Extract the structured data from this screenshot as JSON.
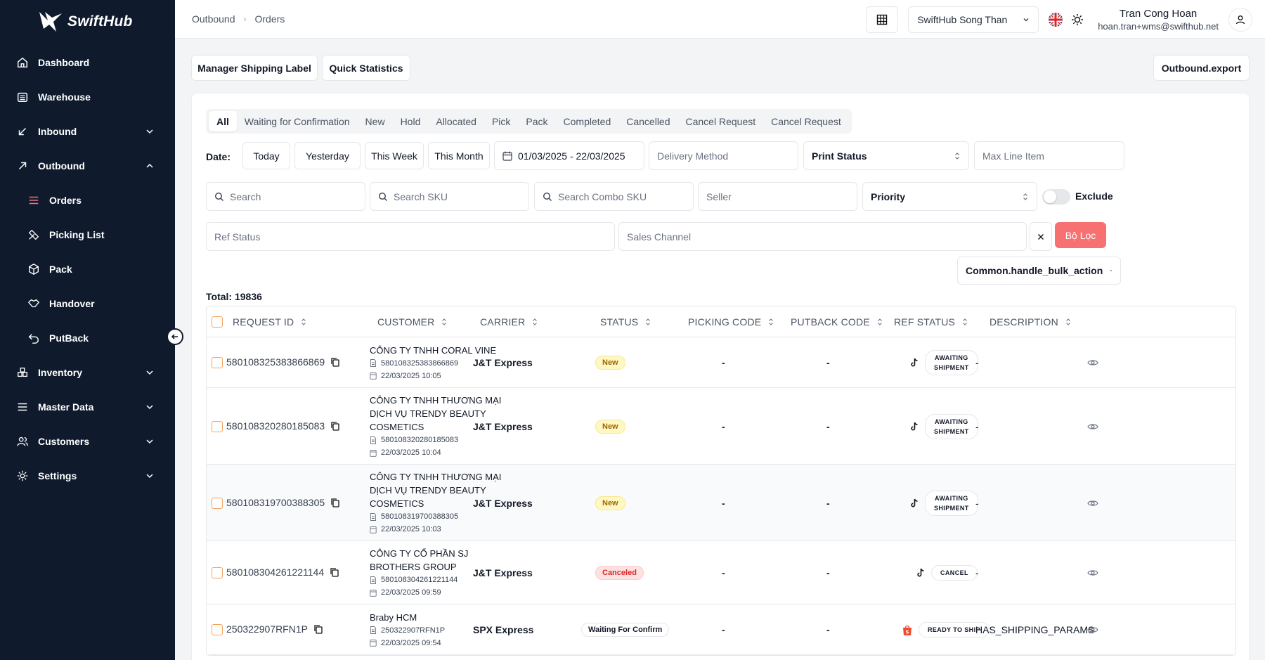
{
  "app": {
    "name": "SwiftHub"
  },
  "sidebar": {
    "items": [
      {
        "label": "Dashboard",
        "icon": "home-icon"
      },
      {
        "label": "Warehouse",
        "icon": "warehouse-icon"
      },
      {
        "label": "Inbound",
        "icon": "arrow-down-left-icon"
      },
      {
        "label": "Outbound",
        "icon": "arrow-up-right-icon"
      },
      {
        "label": "Inventory",
        "icon": "inventory-icon"
      },
      {
        "label": "Master Data",
        "icon": "list-icon"
      },
      {
        "label": "Customers",
        "icon": "users-icon"
      },
      {
        "label": "Settings",
        "icon": "gear-icon"
      }
    ],
    "outbound_sub": [
      {
        "label": "Orders",
        "icon": "list-icon"
      },
      {
        "label": "Picking List",
        "icon": "picking-icon"
      },
      {
        "label": "Pack",
        "icon": "box-icon"
      },
      {
        "label": "Handover",
        "icon": "handshake-icon"
      },
      {
        "label": "PutBack",
        "icon": "undo-icon"
      }
    ]
  },
  "breadcrumb": [
    "Outbound",
    "Orders"
  ],
  "header": {
    "warehouse": "SwiftHub Song Than",
    "user_name": "Tran Cong Hoan",
    "user_email": "hoan.tran+wms@swifthub.net"
  },
  "toolbar": {
    "manager_label": "Manager Shipping Label",
    "quick_stats": "Quick Statistics",
    "export": "Outbound.export"
  },
  "tabs": [
    "All",
    "Waiting for Confirmation",
    "New",
    "Hold",
    "Allocated",
    "Pick",
    "Pack",
    "Completed",
    "Cancelled",
    "Cancel Request",
    "Cancel Request"
  ],
  "filters": {
    "date_label": "Date:",
    "today": "Today",
    "yesterday": "Yesterday",
    "this_week": "This Week",
    "this_month": "This Month",
    "date_range": "01/03/2025 - 22/03/2025",
    "delivery_method": "Delivery Method",
    "print_status": "Print Status",
    "max_line_item": "Max Line Item",
    "search": "Search",
    "search_sku": "Search SKU",
    "search_combo_sku": "Search Combo SKU",
    "seller": "Seller",
    "priority": "Priority",
    "exclude": "Exclude",
    "ref_status": "Ref Status",
    "sales_channel": "Sales Channel",
    "apply": "Bộ Lọc",
    "bulk_action": "Common.handle_bulk_action"
  },
  "total": "Total: 19836",
  "table": {
    "columns": [
      "REQUEST ID",
      "CUSTOMER",
      "CARRIER",
      "STATUS",
      "PICKING CODE",
      "PUTBACK CODE",
      "REF STATUS",
      "DESCRIPTION"
    ],
    "rows": [
      {
        "id": "580108325383866869",
        "customer_lines": [
          "CÔNG TY TNHH CORAL VINE"
        ],
        "order_no": "580108325383866869",
        "date": "22/03/2025 10:05",
        "carrier": "J&T Express",
        "status": "New",
        "status_kind": "new",
        "picking": "-",
        "putback": "-",
        "channel_icon": "tiktok-icon",
        "ref_lines": [
          "AWAITING",
          "SHIPMENT"
        ],
        "description": "-"
      },
      {
        "id": "580108320280185083",
        "customer_lines": [
          "CÔNG TY TNHH THƯƠNG MẠI",
          "DỊCH VỤ TRENDY BEAUTY",
          "COSMETICS"
        ],
        "order_no": "580108320280185083",
        "date": "22/03/2025 10:04",
        "carrier": "J&T Express",
        "status": "New",
        "status_kind": "new",
        "picking": "-",
        "putback": "-",
        "channel_icon": "tiktok-icon",
        "ref_lines": [
          "AWAITING",
          "SHIPMENT"
        ],
        "description": "-"
      },
      {
        "id": "580108319700388305",
        "customer_lines": [
          "CÔNG TY TNHH THƯƠNG MẠI",
          "DỊCH VỤ TRENDY BEAUTY",
          "COSMETICS"
        ],
        "order_no": "580108319700388305",
        "date": "22/03/2025 10:03",
        "carrier": "J&T Express",
        "status": "New",
        "status_kind": "new",
        "picking": "-",
        "putback": "-",
        "channel_icon": "tiktok-icon",
        "ref_lines": [
          "AWAITING",
          "SHIPMENT"
        ],
        "description": "-"
      },
      {
        "id": "580108304261221144",
        "customer_lines": [
          "CÔNG TY CỔ PHẦN SJ",
          "BROTHERS GROUP"
        ],
        "order_no": "580108304261221144",
        "date": "22/03/2025 09:59",
        "carrier": "J&T Express",
        "status": "Canceled",
        "status_kind": "canceled",
        "picking": "-",
        "putback": "-",
        "channel_icon": "tiktok-icon",
        "ref_lines": [
          "CANCEL"
        ],
        "description": "-"
      },
      {
        "id": "250322907RFN1P",
        "customer_lines": [
          "Braby HCM"
        ],
        "order_no": "250322907RFN1P",
        "date": "22/03/2025 09:54",
        "carrier": "SPX Express",
        "status": "Waiting For Confirm",
        "status_kind": "waiting",
        "picking": "-",
        "putback": "-",
        "channel_icon": "shopee-icon",
        "ref_lines": [
          "READY TO SHIP"
        ],
        "description": "HAS_SHIPPING_PARAMS"
      }
    ]
  },
  "colors": {
    "sidebar_bg": "#0f1b2d",
    "accent": "#f87171",
    "checkbox": "#f5a35c"
  }
}
